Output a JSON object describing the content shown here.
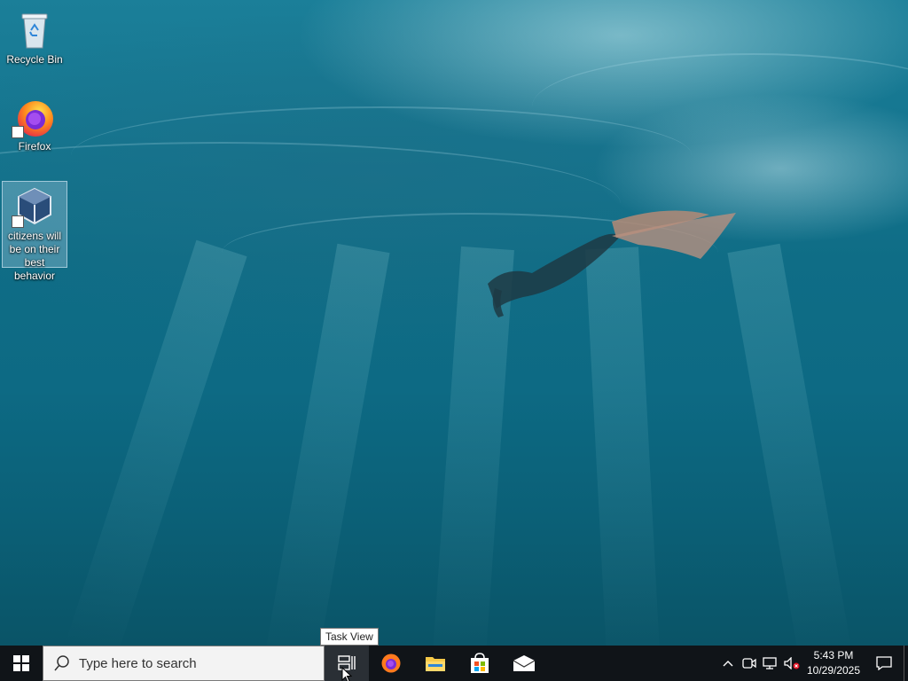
{
  "desktop": {
    "icons": [
      {
        "label": "Recycle Bin",
        "icon": "recycle-bin-icon"
      },
      {
        "label": "Firefox",
        "icon": "firefox-icon"
      },
      {
        "label": "citizens will be on their best behavior",
        "icon": "virtualbox-icon"
      }
    ]
  },
  "tooltip": {
    "text": "Task View"
  },
  "taskbar": {
    "search_placeholder": "Type here to search",
    "pinned": [
      "task-view-icon",
      "firefox-icon",
      "file-explorer-icon",
      "microsoft-store-icon",
      "mail-icon"
    ],
    "clock": {
      "time": "5:43 PM",
      "date": "10/29/2025"
    }
  },
  "colors": {
    "taskbar_bg": "#101418",
    "wallpaper_water": "#0f6d86"
  }
}
